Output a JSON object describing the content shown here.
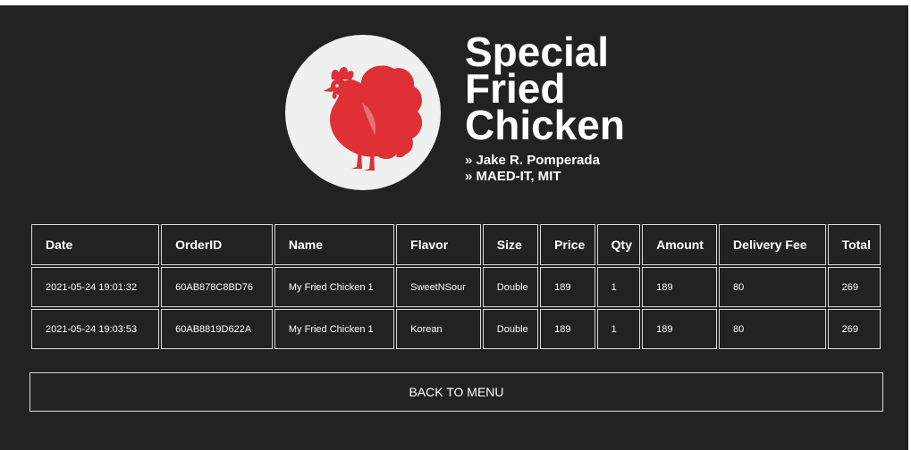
{
  "header": {
    "title_lines": [
      "Special",
      "Fried",
      "Chicken"
    ],
    "author_line": "» Jake R. Pomperada",
    "credentials_line": "» MAED-IT, MIT",
    "logo_icon": "rooster-icon",
    "logo_color": "#de3035",
    "logo_background": "#eff0f0"
  },
  "table": {
    "columns": [
      "Date",
      "OrderID",
      "Name",
      "Flavor",
      "Size",
      "Price",
      "Qty",
      "Amount",
      "Delivery Fee",
      "Total"
    ],
    "rows": [
      [
        "2021-05-24 19:01:32",
        "60AB878C8BD76",
        "My Fried Chicken 1",
        "SweetNSour",
        "Double",
        "189",
        "1",
        "189",
        "80",
        "269"
      ],
      [
        "2021-05-24 19:03:53",
        "60AB8819D622A",
        "My Fried Chicken 1",
        "Korean",
        "Double",
        "189",
        "1",
        "189",
        "80",
        "269"
      ]
    ]
  },
  "footer": {
    "back_label": "BACK TO MENU"
  },
  "colors": {
    "background": "#222222",
    "text": "#ffffff",
    "border": "#d9d9d9"
  }
}
